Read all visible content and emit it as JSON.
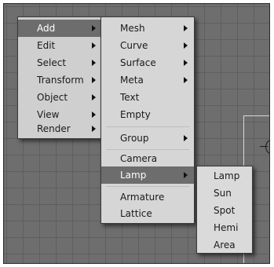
{
  "main_menu": {
    "items": [
      {
        "label": "Add",
        "has_submenu": true,
        "highlighted": true
      },
      {
        "label": "Edit",
        "has_submenu": true
      },
      {
        "label": "Select",
        "has_submenu": true
      },
      {
        "label": "Transform",
        "has_submenu": true
      },
      {
        "label": "Object",
        "has_submenu": true
      },
      {
        "label": "View",
        "has_submenu": true
      },
      {
        "label": "Render",
        "has_submenu": true
      }
    ]
  },
  "add_menu": {
    "items": [
      {
        "label": "Mesh",
        "has_submenu": true
      },
      {
        "label": "Curve",
        "has_submenu": true
      },
      {
        "label": "Surface",
        "has_submenu": true
      },
      {
        "label": "Meta",
        "has_submenu": true
      },
      {
        "label": "Text",
        "has_submenu": false
      },
      {
        "label": "Empty",
        "has_submenu": false
      },
      {
        "label": "Group",
        "has_submenu": true
      },
      {
        "label": "Camera",
        "has_submenu": false
      },
      {
        "label": "Lamp",
        "has_submenu": true,
        "highlighted": true
      },
      {
        "label": "Armature",
        "has_submenu": false
      },
      {
        "label": "Lattice",
        "has_submenu": false
      }
    ]
  },
  "lamp_menu": {
    "items": [
      {
        "label": "Lamp"
      },
      {
        "label": "Sun"
      },
      {
        "label": "Spot"
      },
      {
        "label": "Hemi"
      },
      {
        "label": "Area"
      }
    ]
  },
  "colors": {
    "viewport_bg": "#6e6e6e",
    "grid_line": "#5f5f5f",
    "menu_bg": "#d9d9d9",
    "highlight_bg": "#6d6d6d",
    "highlight_text": "#ffffff"
  }
}
